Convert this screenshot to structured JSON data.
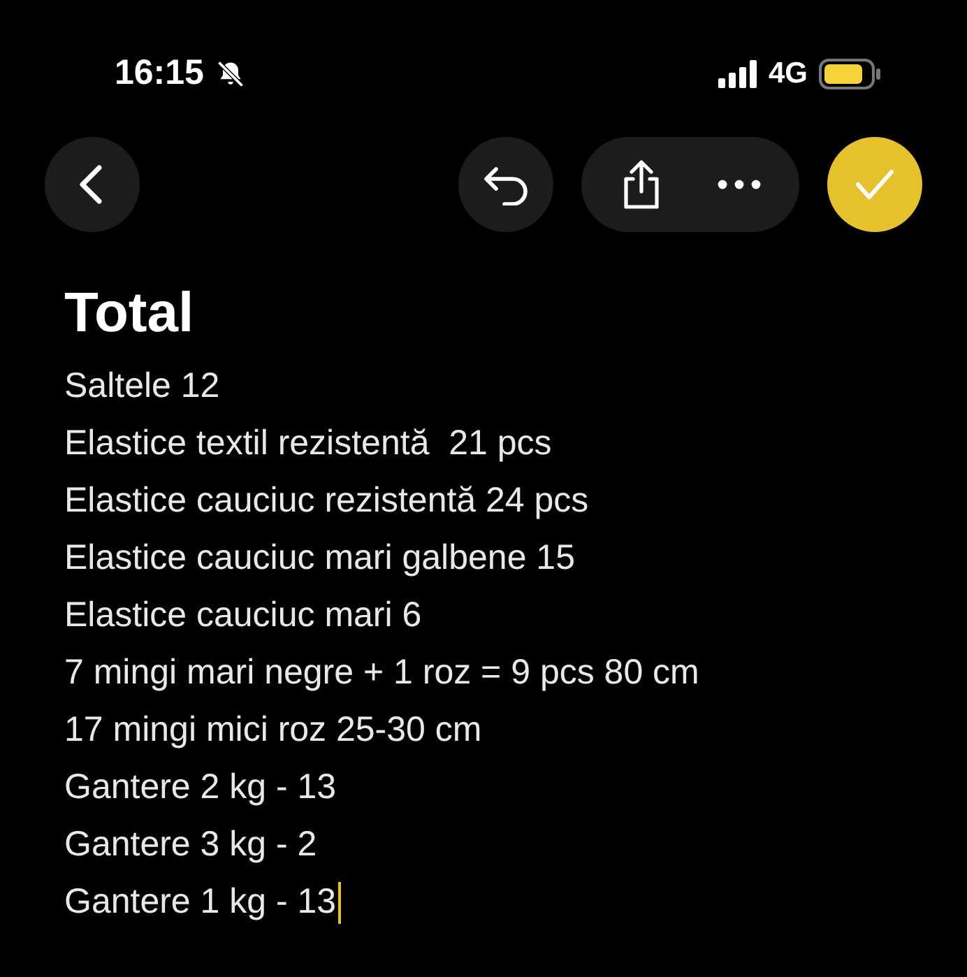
{
  "status_bar": {
    "time": "16:15",
    "network": "4G"
  },
  "note": {
    "title": "Total",
    "lines": [
      "Saltele 12",
      "Elastice textil rezistentă  21 pcs",
      "Elastice cauciuc rezistentă 24 pcs",
      "Elastice cauciuc mari galbene 15",
      "Elastice cauciuc mari 6",
      "7 mingi mari negre + 1 roz = 9 pcs 80 cm",
      "17 mingi mici roz 25-30 cm",
      "Gantere 2 kg - 13",
      "Gantere 3 kg - 2",
      "Gantere 1 kg - 13"
    ]
  }
}
